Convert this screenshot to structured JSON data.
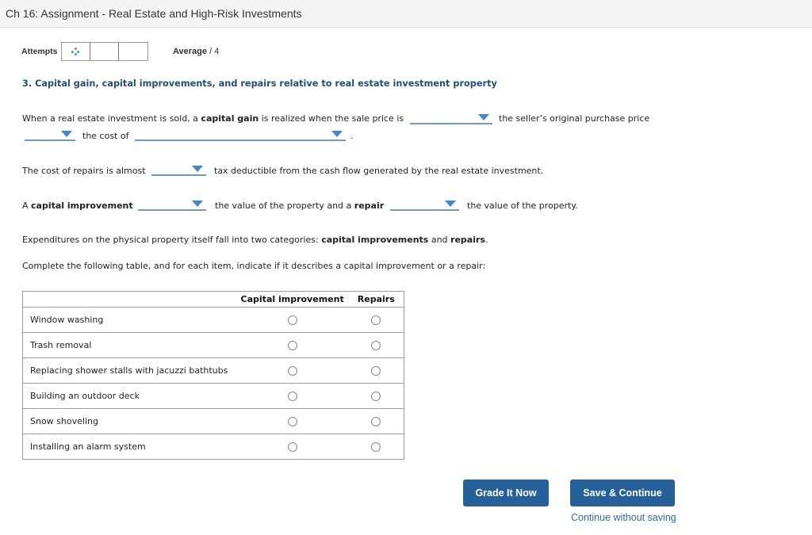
{
  "header": {
    "title": "Ch 16: Assignment - Real Estate and High-Risk Investments"
  },
  "attempts": {
    "label": "Attempts",
    "boxes": 3,
    "first_box_icon": "loading-dots-icon"
  },
  "average": {
    "label": "Average",
    "value": "/ 4"
  },
  "question": {
    "title": "3. Capital gain, capital improvements, and repairs relative to real estate investment property",
    "sentence1": {
      "part1": "When a real estate investment is sold, a ",
      "bold1": "capital gain",
      "part2": " is realized when the sale price is",
      "dropdown1": "",
      "part3": "the seller’s original purchase price",
      "dropdown2": "",
      "part4": "the cost of",
      "dropdown3": "",
      "end": "."
    },
    "sentence2": {
      "part1": "The cost of repairs is almost",
      "dropdown1": "",
      "part2": "tax deductible from the cash flow generated by the real estate investment."
    },
    "sentence3": {
      "part1": "A ",
      "bold1": "capital improvement",
      "dropdown1": "",
      "part2": "the value of the property and a ",
      "bold2": "repair",
      "dropdown2": "",
      "part3": "the value of the property."
    },
    "para1": {
      "part1": "Expenditures on the physical property itself fall into two categories: ",
      "bold1": "capital improvements",
      "part2": " and ",
      "bold2": "repairs",
      "end": "."
    },
    "para2": "Complete the following table, and for each item, indicate if it describes a capital improvement or a repair:",
    "table": {
      "headers": [
        "",
        "Capital improvement",
        "Repairs"
      ],
      "rows": [
        {
          "label": "Window washing",
          "selected": null
        },
        {
          "label": "Trash removal",
          "selected": null
        },
        {
          "label": "Replacing shower stalls with jacuzzi bathtubs",
          "selected": null
        },
        {
          "label": "Building an outdoor deck",
          "selected": null
        },
        {
          "label": "Snow shoveling",
          "selected": null
        },
        {
          "label": "Installing an alarm system",
          "selected": null
        }
      ]
    }
  },
  "actions": {
    "grade_label": "Grade It Now",
    "save_label": "Save & Continue",
    "continue_label": "Continue without saving"
  },
  "colors": {
    "button_bg": "#26609a",
    "title_blue": "#1f4e79",
    "dropdown_caret": "#3f86cf",
    "link": "#2a6aa8"
  }
}
